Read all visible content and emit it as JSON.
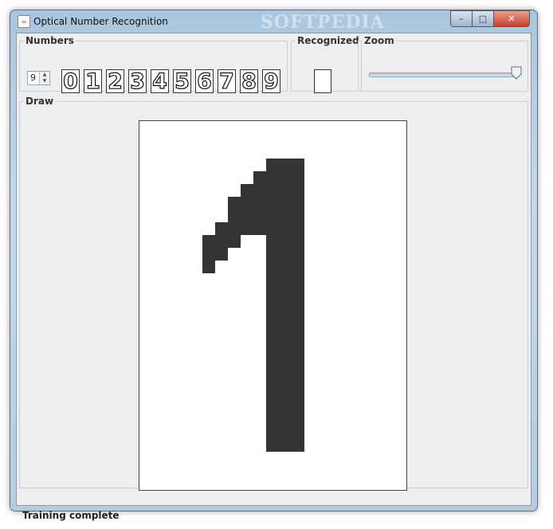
{
  "window": {
    "title": "Optical Number Recognition",
    "watermark": "SOFTPEDIA",
    "controls": {
      "minimize": "–",
      "maximize": "□",
      "close": "✕"
    }
  },
  "numbers_panel": {
    "legend": "Numbers",
    "spinner_value": "9",
    "digits": [
      "0",
      "1",
      "2",
      "3",
      "4",
      "5",
      "6",
      "7",
      "8",
      "9"
    ]
  },
  "recognized_panel": {
    "legend": "Recognized",
    "value": ""
  },
  "zoom_panel": {
    "legend": "Zoom",
    "level_fraction": 1.0
  },
  "draw_panel": {
    "legend": "Draw",
    "drawn_digit": "1"
  },
  "status": {
    "text": "Training complete"
  },
  "icons": [
    "java-app-icon",
    "spinner-up-icon",
    "spinner-down-icon"
  ]
}
